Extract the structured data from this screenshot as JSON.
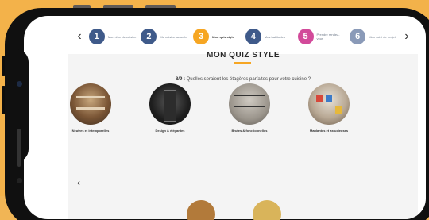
{
  "colors": {
    "background": "#f3b24a",
    "accent": "#f6a623",
    "step_default": "#3f5a8a"
  },
  "steps": [
    {
      "number": "1",
      "label": "Mon rêve de cuisine"
    },
    {
      "number": "2",
      "label": "Ma cuisine actuelle"
    },
    {
      "number": "3",
      "label": "Mon quiz style"
    },
    {
      "number": "4",
      "label": "Mes habitudes"
    },
    {
      "number": "5",
      "label": "Prendre rendez-vous"
    },
    {
      "number": "6",
      "label": "Mon suivi de projet"
    }
  ],
  "current_step": "3",
  "quiz": {
    "title": "MON QUIZ STYLE",
    "progress": "8/9",
    "question": "Quelles seraient les étagères parfaites pour votre cuisine ?",
    "options": [
      {
        "label": "Neutres et intemporelles",
        "icon": "shelf-photo-wood"
      },
      {
        "label": "Design & élégantes",
        "icon": "shelf-photo-black"
      },
      {
        "label": "Brutes & fonctionnelles",
        "icon": "shelf-photo-metal"
      },
      {
        "label": "Maulantes et astucieuses",
        "icon": "shelf-photo-colorful"
      }
    ]
  },
  "nav": {
    "prev_icon": "chevron-left-icon",
    "next_icon": "chevron-right-icon"
  }
}
